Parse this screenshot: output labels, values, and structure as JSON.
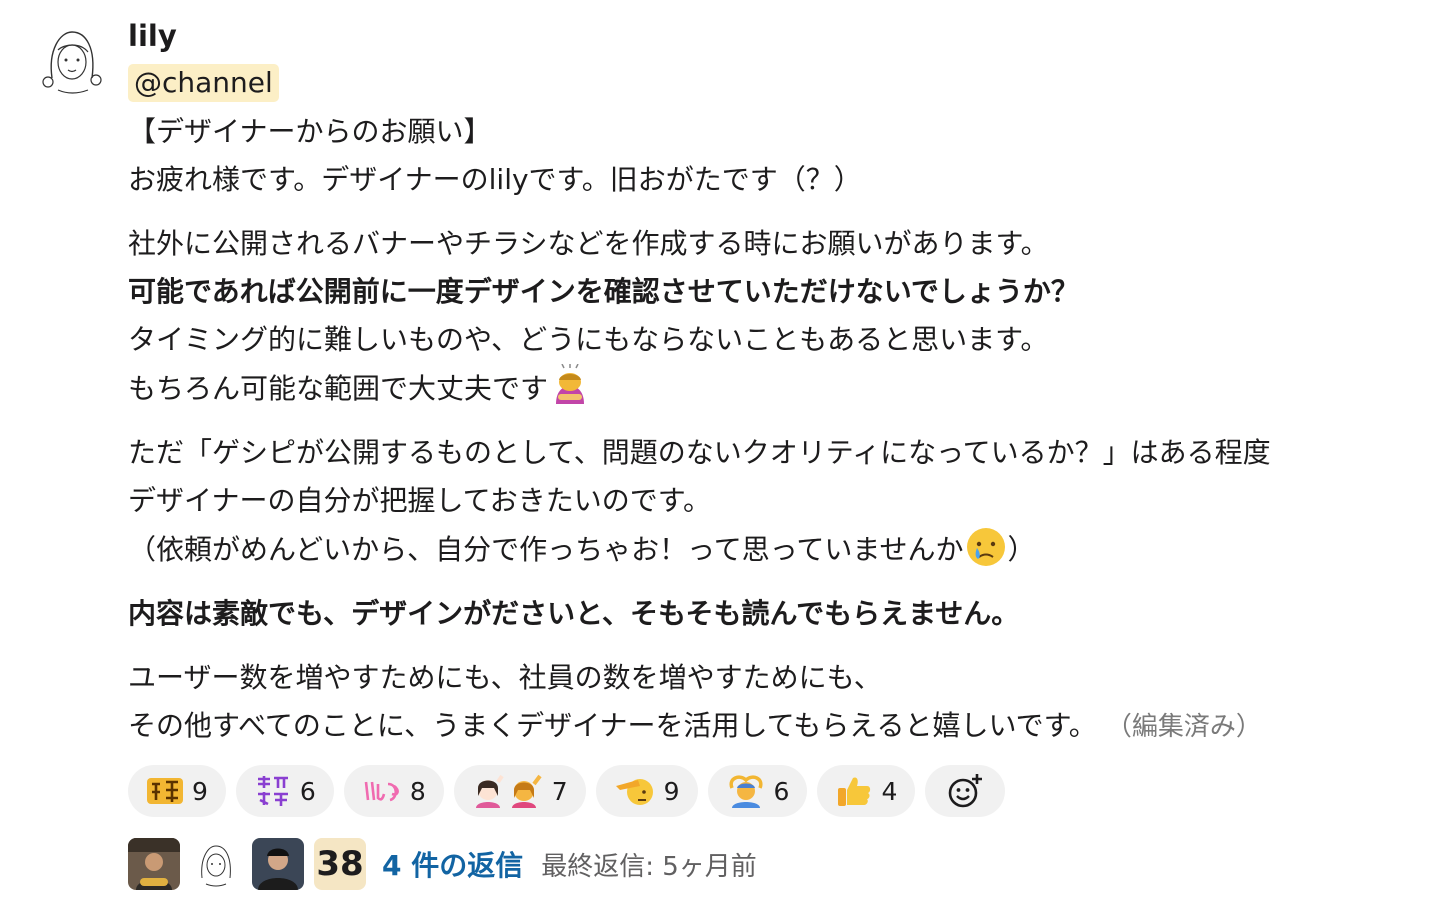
{
  "message": {
    "user": "lily",
    "mention": "@channel",
    "lines": {
      "l1": "【デザイナーからのお願い】",
      "l2": "お疲れ様です。デザイナーのlilyです。旧おがたです（？）",
      "l3": "社外に公開されるバナーやチラシなどを作成する時にお願いがあります。",
      "l4": "可能であれば公開前に一度デザインを確認させていただけないでしょうか？",
      "l5": "タイミング的に難しいものや、どうにもならないこともあると思います。",
      "l6": "もちろん可能な範囲で大丈夫です",
      "l7": "ただ「ゲシピが公開するものとして、問題のないクオリティになっているか？」はある程度",
      "l8": "デザイナーの自分が把握しておきたいのです。",
      "l9a": "（依頼がめんどいから、自分で作っちゃお！って思っていませんか",
      "l9b": "）",
      "l10": "内容は素敵でも、デザインがださいと、そもそも読んでもらえません。",
      "l11": "ユーザー数を増やすためにも、社員の数を増やすためにも、",
      "l12": "その他すべてのことに、うまくデザイナーを活用してもらえると嬉しいです。"
    },
    "edited_label": "（編集済み）"
  },
  "reactions": [
    {
      "icon": "ijin-kanji-icon",
      "count": "9"
    },
    {
      "icon": "kakunin-shimasu-icon",
      "count": "6"
    },
    {
      "icon": "iiyo-text-icon",
      "count": "8"
    },
    {
      "icon": "raising-hand-person-icon",
      "count": "7"
    },
    {
      "icon": "saluting-face-icon",
      "count": "9"
    },
    {
      "icon": "person-gesturing-ok-icon",
      "count": "6"
    },
    {
      "icon": "thumbs-up-icon",
      "count": "4"
    }
  ],
  "thread": {
    "participants_count": "38",
    "reply_count": "4 件の返信",
    "last_reply": "最終返信: 5ヶ月前"
  },
  "colors": {
    "mention_bg": "#fcefc6",
    "link": "#1264a3",
    "reaction_bg": "#f1f1f1"
  }
}
